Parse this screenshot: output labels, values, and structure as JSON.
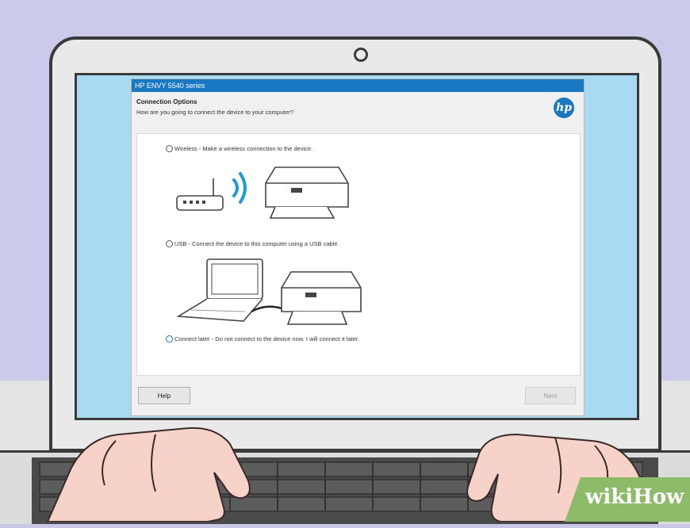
{
  "window": {
    "title": "HP ENVY 5540 series"
  },
  "header": {
    "title": "Connection Options",
    "subtitle": "How are you going to connect the device to your computer?",
    "logo_text": "hp"
  },
  "options": [
    {
      "label": "Wireless - Make a wireless connection to the device.",
      "selected": false
    },
    {
      "label": "USB - Connect the device to this computer using a USB cable.",
      "selected": false
    },
    {
      "label": "Connect later - Do not connect to the device now. I will connect it later.",
      "selected": false
    }
  ],
  "footer": {
    "help_label": "Help",
    "next_label": "Next"
  },
  "colors": {
    "accent": "#1a78c2",
    "screen_background": "#aad9f4",
    "wall": "#cbcaea"
  },
  "watermark": {
    "text": "wikiHow"
  }
}
